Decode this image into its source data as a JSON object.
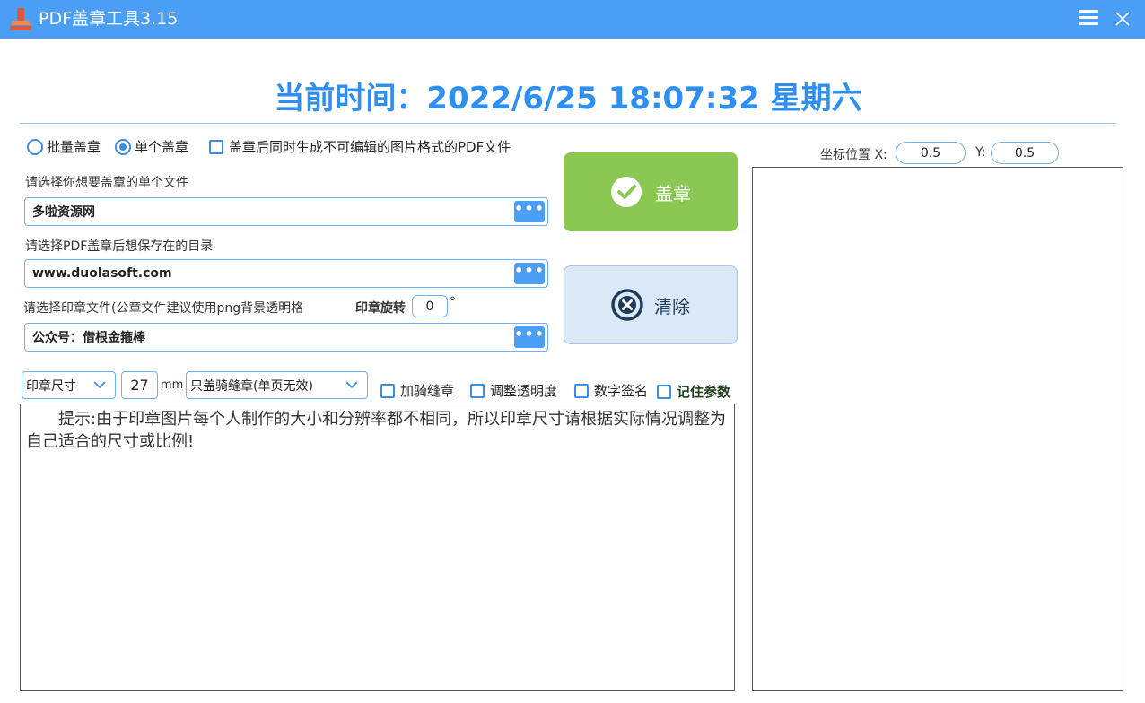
{
  "window": {
    "title": "PDF盖章工具3.15"
  },
  "clock": {
    "text": "当前时间：2022/6/25 18:07:32  星期六"
  },
  "mode": {
    "batch_label": "批量盖章",
    "single_label": "单个盖章",
    "selected": "single",
    "image_pdf_label": "盖章后同时生成不可编辑的图片格式的PDF文件"
  },
  "file_select": {
    "label": "请选择你想要盖章的单个文件",
    "value": "多啦资源网"
  },
  "save_dir": {
    "label": "请选择PDF盖章后想保存在的目录",
    "value": "www.duolasoft.com"
  },
  "seal_file": {
    "label": "请选择印章文件(公章文件建议使用png背景透明格",
    "rotation_label": "印章旋转",
    "rotation_value": "0",
    "degree_sign": "°",
    "value": "公众号：借根金箍棒"
  },
  "buttons": {
    "stamp_label": "盖章",
    "clear_label": "清除",
    "browse_dots": "•••"
  },
  "size_row": {
    "size_select": "印章尺寸",
    "size_value": "27",
    "unit": "mm",
    "seam_select": "只盖骑缝章(单页无效)",
    "seam_label": "加骑缝章",
    "opacity_label": "调整透明度",
    "signature_label": "数字签名",
    "remember_label": "记住参数"
  },
  "tip": {
    "text": "提示:由于印章图片每个人制作的大小和分辨率都不相同，所以印章尺寸请根据实际情况调整为自己适合的尺寸或比例!"
  },
  "coords": {
    "label": "坐标位置 X:",
    "x_value": "0.5",
    "y_label": "Y:",
    "y_value": "0.5"
  },
  "colors": {
    "titlebar": "#4b9ef5",
    "clock": "#2f8ff0",
    "stamp_button": "#8ac853",
    "clear_button": "#dbe9f6"
  }
}
